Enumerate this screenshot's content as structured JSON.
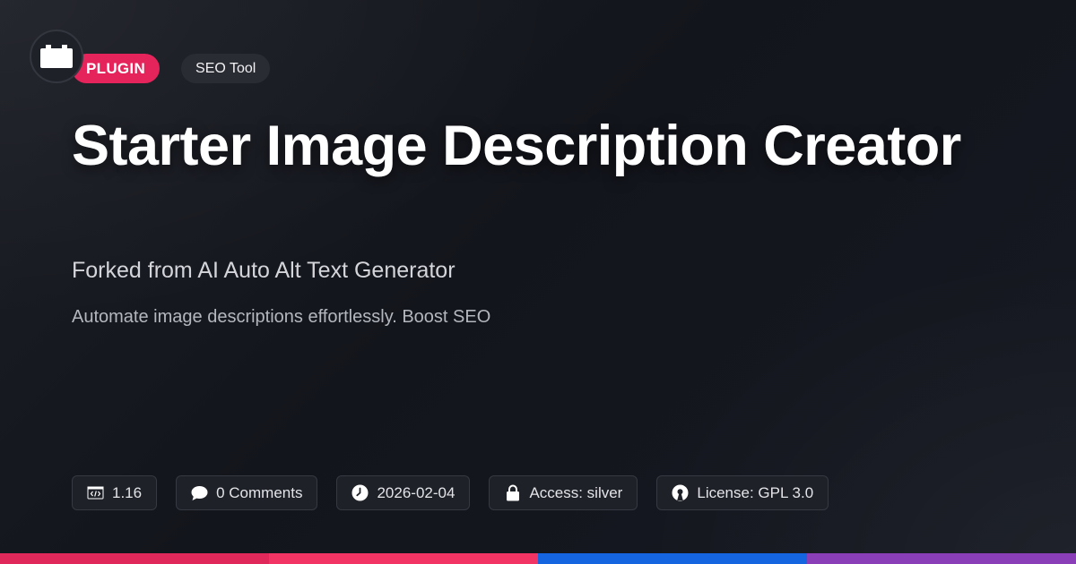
{
  "logo": {
    "icon": "plugin-block-icon"
  },
  "badges": {
    "type_label": "PLUGIN",
    "category_label": "SEO Tool"
  },
  "title": "Starter Image Description Creator",
  "subtitle": "Forked from AI Auto Alt Text Generator",
  "description": "Automate image descriptions effortlessly. Boost SEO",
  "meta": {
    "version": {
      "icon": "code-window-icon",
      "text": "1.16"
    },
    "comments": {
      "icon": "chat-bubble-icon",
      "text": "0 Comments"
    },
    "date": {
      "icon": "clock-icon",
      "text": "2026-02-04"
    },
    "access": {
      "icon": "lock-icon",
      "text": "Access: silver"
    },
    "license": {
      "icon": "open-source-icon",
      "text": "License: GPL 3.0"
    }
  },
  "colors": {
    "badge_plugin": "#e4245a",
    "stripe": [
      "#e0285a",
      "#f23465",
      "#1565e0",
      "#8a3fb8"
    ]
  }
}
